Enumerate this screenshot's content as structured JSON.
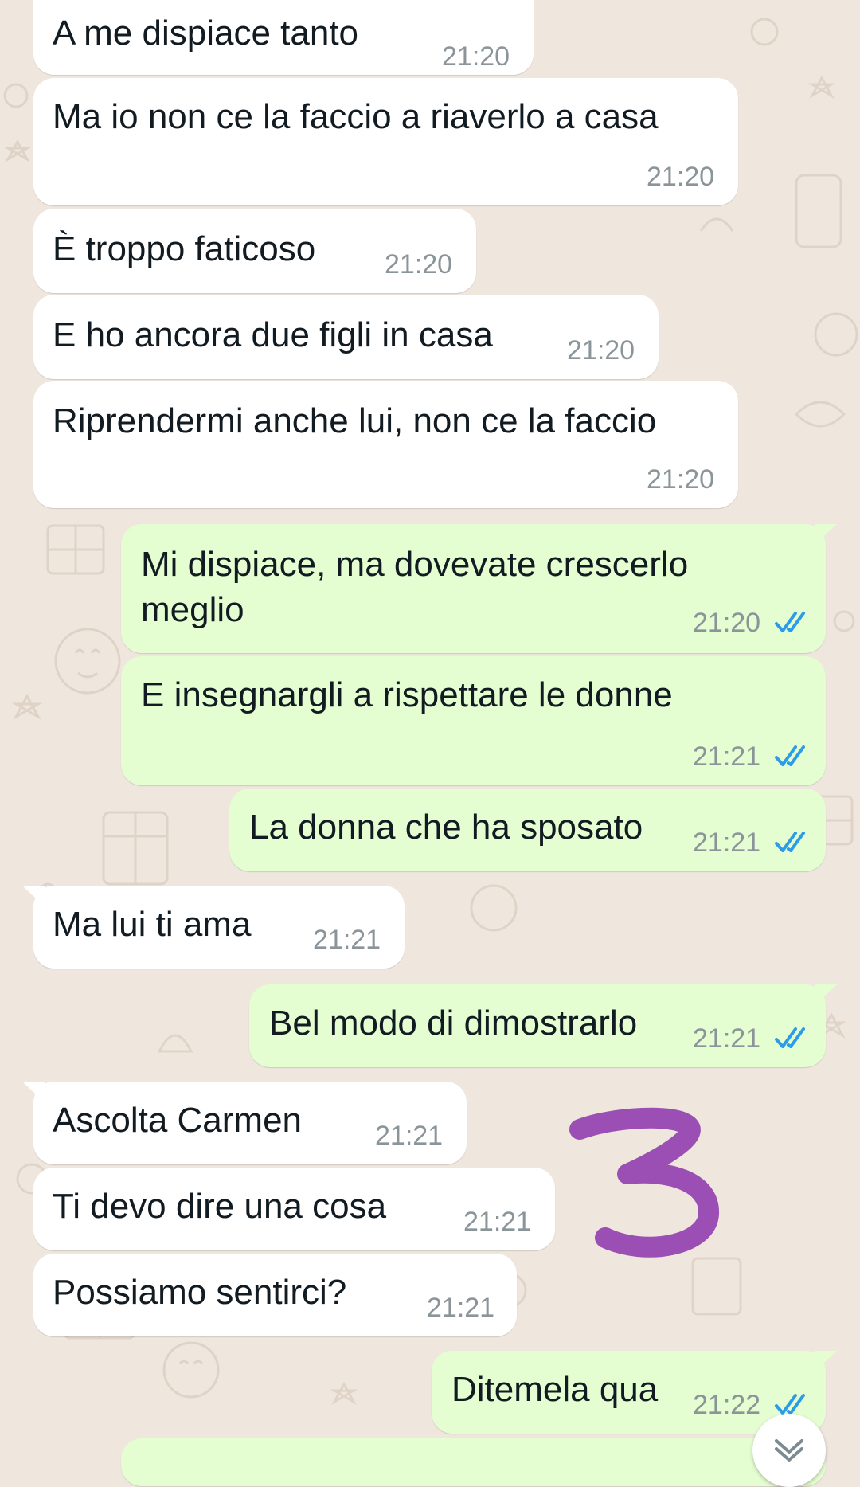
{
  "colors": {
    "wallpaper": "#efe7de",
    "incoming_bubble": "#ffffff",
    "outgoing_bubble": "#e4fdd1",
    "read_ticks": "#2d9ce8",
    "annotation": "#9b4fb5"
  },
  "messages": [
    {
      "direction": "incoming",
      "text": "A me dispiace tanto",
      "time": "21:20"
    },
    {
      "direction": "incoming",
      "text": "Ma io non ce la faccio a riaverlo a casa",
      "time": "21:20"
    },
    {
      "direction": "incoming",
      "text": "È troppo faticoso",
      "time": "21:20"
    },
    {
      "direction": "incoming",
      "text": "E ho ancora due figli in casa",
      "time": "21:20"
    },
    {
      "direction": "incoming",
      "text": "Riprendermi anche lui, non ce la faccio",
      "time": "21:20"
    },
    {
      "direction": "outgoing",
      "text": "Mi dispiace, ma dovevate crescerlo\nmeglio",
      "time": "21:20",
      "status": "read"
    },
    {
      "direction": "outgoing",
      "text": "E insegnargli a rispettare le donne",
      "time": "21:21",
      "status": "read"
    },
    {
      "direction": "outgoing",
      "text": "La donna che ha sposato",
      "time": "21:21",
      "status": "read"
    },
    {
      "direction": "incoming",
      "text": "Ma lui ti ama",
      "time": "21:21"
    },
    {
      "direction": "outgoing",
      "text": "Bel modo di dimostrarlo",
      "time": "21:21",
      "status": "read"
    },
    {
      "direction": "incoming",
      "text": "Ascolta Carmen",
      "time": "21:21"
    },
    {
      "direction": "incoming",
      "text": "Ti devo dire una cosa",
      "time": "21:21"
    },
    {
      "direction": "incoming",
      "text": "Possiamo sentirci?",
      "time": "21:21"
    },
    {
      "direction": "outgoing",
      "text": "Ditemela qua",
      "time": "21:22",
      "status": "read"
    }
  ],
  "annotation": {
    "text": "3",
    "icon": "handwritten-number"
  },
  "scroll_button": {
    "icon": "chevron-down-icon"
  }
}
